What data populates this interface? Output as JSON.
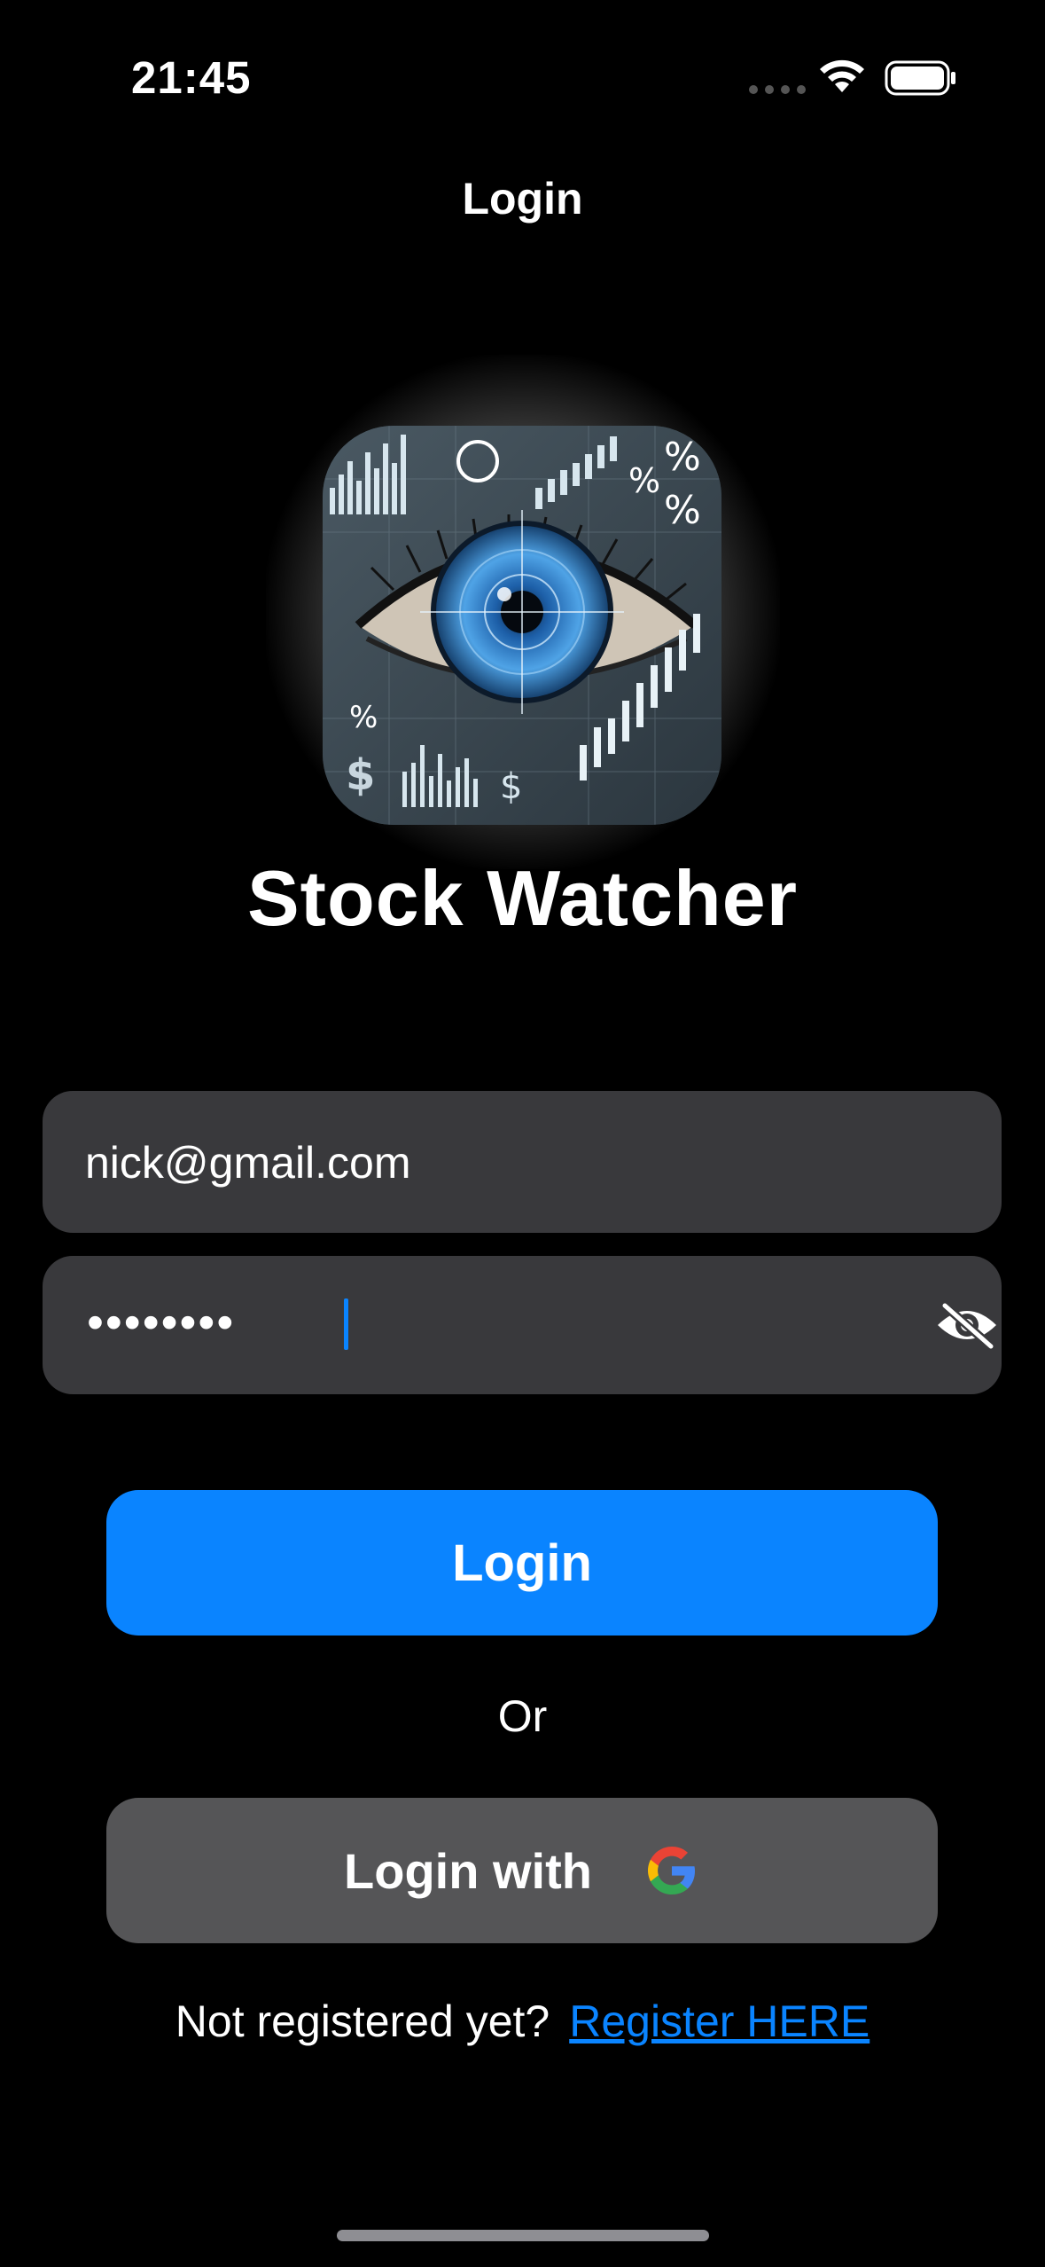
{
  "status_bar": {
    "time": "21:45"
  },
  "nav": {
    "title": "Login"
  },
  "app": {
    "name": "Stock Watcher",
    "logo_icon": "eye-stock-chart-logo"
  },
  "form": {
    "email_value": "nick@gmail.com",
    "password_mask": "••••••••",
    "password_toggle_icon": "eye-slash-icon"
  },
  "actions": {
    "login_label": "Login",
    "or_label": "Or",
    "google_login_label": "Login with",
    "google_icon": "google-g-icon"
  },
  "register": {
    "prompt": "Not registered yet?",
    "link_label": "Register HERE"
  },
  "colors": {
    "background": "#000000",
    "accent": "#0a84ff",
    "field_bg": "#39393c",
    "secondary_button_bg": "#555557"
  }
}
